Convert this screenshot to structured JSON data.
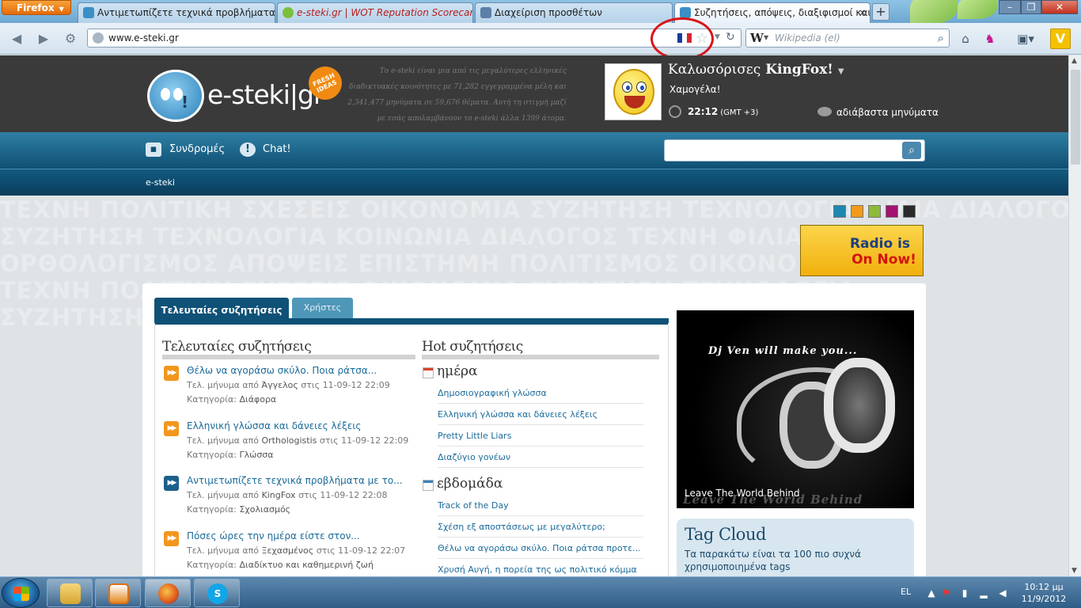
{
  "browser": {
    "app_button": "Firefox",
    "tabs": [
      {
        "title": "Αντιμετωπίζετε τεχνικά προβλήματα..."
      },
      {
        "title": "e-steki.gr | WOT Reputation Scorecard..."
      },
      {
        "title": "Διαχείριση προσθέτων"
      },
      {
        "title": "Συζητήσεις, απόψεις, διαξιφισμοί και..."
      }
    ],
    "url": "www.e-steki.gr",
    "search_placeholder": "Wikipedia (el)",
    "search_engine_icon": "W"
  },
  "site": {
    "logo_text": "e-steki|gr",
    "badge_text": "FRESH IDEAS",
    "blurb": "Το e-steki είναι μια από τις μεγαλύτερες ελληνικές διαδικτυακές κοινότητες με 71,282 εγγεγραμμένα μέλη και 2,341,477 μηνύματα σε 59,676 θέματα. Αυτή τη στιγμή μαζί με εσάς απολαμβάνουν το e-steki άλλα 1399 άτομα.",
    "greeting": "Καλωσόρισες",
    "username": "KingFox!",
    "status": "Χαμογέλα!",
    "time": "22:12",
    "timezone": "(GMT +3)",
    "messages": "αδιάβαστα μηνύματα",
    "nav": {
      "subscriptions": "Συνδρομές",
      "chat": "Chat!"
    },
    "breadcrumb": "e-steki",
    "radio": {
      "line1": "Radio is",
      "line2": "On Now!"
    },
    "swatch_colors": [
      "#1f88b0",
      "#f39a1b",
      "#8dbb3a",
      "#a3136f",
      "#2a2a2a"
    ],
    "bg_words": [
      "ΤΕΧΝΗ ΠΟΛΙΤΙΚΗ ΣΧΕΣΕΙΣ ΟΙΚΟΝΟΜΙΑ ΣΥΖΗΤΗΣΗ ΤΕΧΝΟΛΟΓΙΑ ΦΙΛΙΑ ΔΙΑΛΟΓΟΣ",
      "ΣΥΖΗΤΗΣΗ ΤΕΧΝΟΛΟΓΙΑ ΚΟΙΝΩΝΙΑ ΔΙΑΛΟΓΟΣ ΤΕΧΝΗ ΦΙΛΙΑ ΣΧΕΣΕΙΣ",
      "ΟΡΘΟΛΟΓΙΣΜΟΣ ΑΠΟΨΕΙΣ ΕΠΙΣΤΗΜΗ ΠΟΛΙΤΙΣΜΟΣ ΟΙΚΟΝΟΜΙΑ",
      "ΤΕΧΝΗ ΠΟΛΙΤΙΚΗ ΣΧΕΣΕΙΣ ΟΙΚΟΝΟΜΙΑ ΣΥΖΗΤΗΣΗ ΤΕΧΝΟΛΟΓΙΑ",
      "ΣΥΖΗΤΗΣΗ ΤΕΧΝΟΛΟΓΙΑ ΚΟΙΝΩΝΙΑ ΔΙΑΛΟΓΟΣ ΣΧΕΣΕΙΣ ΟΙΚΟΝΟΜΙΑ"
    ]
  },
  "content": {
    "tabs": {
      "active": "Τελευταίες συζητήσεις",
      "inactive": "Χρήστες"
    },
    "latest": {
      "title": "Τελευταίες συζητήσεις",
      "items": [
        {
          "title": "Θέλω να αγοράσω σκύλο. Ποια ράτσα...",
          "meta_prefix": "Τελ. μήνυμα από",
          "author": "Άγγελος",
          "meta_mid": "στις",
          "when": "11-09-12 22:09",
          "cat_label": "Κατηγορία:",
          "category": "Διάφορα"
        },
        {
          "title": "Ελληνική γλώσσα και δάνειες λέξεις",
          "meta_prefix": "Τελ. μήνυμα από",
          "author": "Orthologistis",
          "meta_mid": "στις",
          "when": "11-09-12 22:09",
          "cat_label": "Κατηγορία:",
          "category": "Γλώσσα"
        },
        {
          "title": "Αντιμετωπίζετε τεχνικά προβλήματα με το...",
          "meta_prefix": "Τελ. μήνυμα από",
          "author": "KingFox",
          "meta_mid": "στις",
          "when": "11-09-12 22:08",
          "cat_label": "Κατηγορία:",
          "category": "Σχολιασμός"
        },
        {
          "title": "Πόσες ώρες την ημέρα είστε στον...",
          "meta_prefix": "Τελ. μήνυμα από",
          "author": "Ξεχασμένος",
          "meta_mid": "στις",
          "when": "11-09-12 22:07",
          "cat_label": "Κατηγορία:",
          "category": "Διαδίκτυο και καθημερινή ζωή"
        }
      ]
    },
    "hot": {
      "title": "Hot συζητήσεις",
      "day_label": "ημέρα",
      "day_links": [
        "Δημοσιογραφική γλώσσα",
        "Ελληνική γλώσσα και δάνειες λέξεις",
        "Pretty Little Liars",
        "Διαζύγιο γονέων"
      ],
      "week_label": "εβδομάδα",
      "week_links": [
        "Track of the Day",
        "Σχέση εξ αποστάσεως με μεγαλύτερο;",
        "Θέλω να αγοράσω σκύλο. Ποια ράτσα προτε...",
        "Χρυσή Αυγή, η πορεία της ως πολιτικό κόμμα"
      ]
    },
    "dj": {
      "title": "Dj Ven will make you...",
      "caption": "Leave The World Behind",
      "caption_big": "Leave The World Behind"
    },
    "tag_cloud": {
      "title": "Tag Cloud",
      "desc": "Τα παρακάτω είναι τα 100 πιο συχνά χρησιμοποιημένα tags"
    }
  },
  "taskbar": {
    "lang": "EL",
    "time": "10:12 μμ",
    "date": "11/9/2012"
  }
}
